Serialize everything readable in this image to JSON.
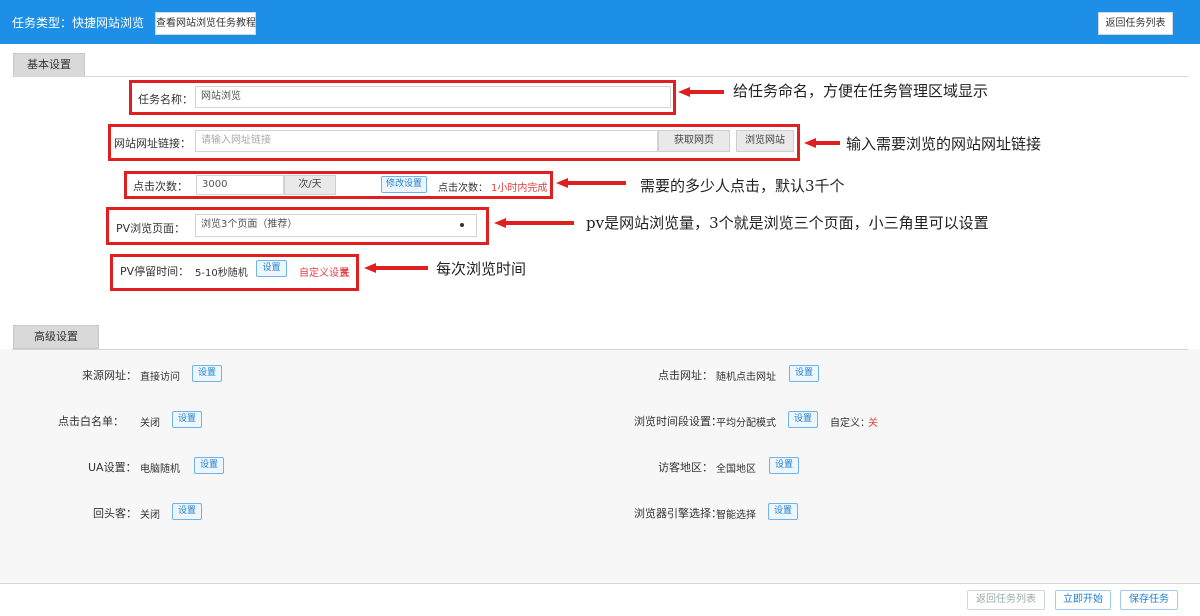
{
  "header": {
    "title": "任务类型：快捷网站浏览",
    "left_button": "查看网站浏览任务教程",
    "right_button": "返回任务列表"
  },
  "basic": {
    "tab": "基本设置",
    "name": {
      "label": "任务名称：",
      "value": "网站浏览"
    },
    "url": {
      "label": "网站网址链接：",
      "placeholder": "请输入网址链接",
      "btn1": "获取网页",
      "btn2": "浏览网站"
    },
    "count": {
      "label": "点击次数：",
      "value": "3000",
      "btn": "次/天",
      "blue_btn": "修改设置",
      "extra": "点击次数：",
      "red": "1小时内完成"
    },
    "pv": {
      "label": "PV浏览页面：",
      "value": "浏览3个页面（推荐）"
    },
    "pvtime": {
      "label": "PV停留时间：",
      "value": "5-10秒随机",
      "blue_btn": "设置",
      "red": "自定义设置",
      "red_mark": "关"
    }
  },
  "annotations": {
    "a1": "给任务命名，方便在任务管理区域显示",
    "a2": "输入需要浏览的网站网址链接",
    "a3": "需要的多少人点击，默认3千个",
    "a4": "pv是网站浏览量，3个就是浏览三个页面，小三角里可以设置",
    "a5": "每次浏览时间"
  },
  "advanced": {
    "tab": "高级设置",
    "rows": [
      {
        "label": "来源网址：",
        "value": "直接访问",
        "btn": "设置"
      },
      {
        "label": "点击网址：",
        "value": "随机点击网址",
        "btn": "设置"
      },
      {
        "label": "点击白名单：",
        "value": "关闭",
        "btn": "设置"
      },
      {
        "label": "浏览时间段设置：",
        "value": "平均分配模式",
        "btn": "设置",
        "extra": "自定义：",
        "extra_red": "关"
      },
      {
        "label": "UA设置：",
        "value": "电脑随机",
        "btn": "设置"
      },
      {
        "label": "访客地区：",
        "value": "全国地区",
        "btn": "设置"
      },
      {
        "label": "回头客：",
        "value": "关闭",
        "btn": "设置"
      },
      {
        "label": "浏览器引擎选择：",
        "value": "智能选择",
        "btn": "设置"
      }
    ]
  },
  "footer": {
    "btn_cancel": "返回任务列表",
    "btn_start": "立即开始",
    "btn_save": "保存任务"
  },
  "colors": {
    "accent": "#1e8fe6",
    "annotation_box": "#e02020"
  }
}
